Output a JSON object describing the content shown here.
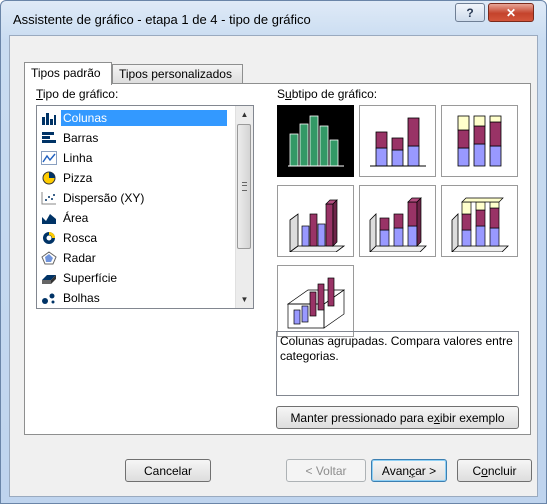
{
  "window": {
    "title": "Assistente de gráfico - etapa 1 de 4 - tipo de gráfico",
    "help_label": "?",
    "close_label": "✕"
  },
  "tabs": [
    {
      "label": "Tipos padrão",
      "active": true
    },
    {
      "label": "Tipos personalizados",
      "active": false
    }
  ],
  "chart_type_list": {
    "label": "Tipo de gráfico:",
    "items": [
      {
        "label": "Colunas",
        "icon": "column-chart-icon",
        "selected": true
      },
      {
        "label": "Barras",
        "icon": "bar-chart-icon"
      },
      {
        "label": "Linha",
        "icon": "line-chart-icon"
      },
      {
        "label": "Pizza",
        "icon": "pie-chart-icon"
      },
      {
        "label": "Dispersão (XY)",
        "icon": "scatter-chart-icon"
      },
      {
        "label": "Área",
        "icon": "area-chart-icon"
      },
      {
        "label": "Rosca",
        "icon": "doughnut-chart-icon"
      },
      {
        "label": "Radar",
        "icon": "radar-chart-icon"
      },
      {
        "label": "Superfície",
        "icon": "surface-chart-icon"
      },
      {
        "label": "Bolhas",
        "icon": "bubble-chart-icon"
      }
    ]
  },
  "subtypes": {
    "label": "Subtipo de gráfico:",
    "items": [
      {
        "name": "clustered-column",
        "selected": true
      },
      {
        "name": "stacked-column"
      },
      {
        "name": "100-stacked-column"
      },
      {
        "name": "3d-clustered-column"
      },
      {
        "name": "3d-stacked-column"
      },
      {
        "name": "3d-100-stacked-column"
      },
      {
        "name": "3d-column"
      }
    ],
    "description": "Colunas agrupadas. Compara valores entre categorias.",
    "preview_button": "Manter pressionado para exibir exemplo"
  },
  "buttons": {
    "cancel": "Cancelar",
    "back": "< Voltar",
    "next": "Avançar >",
    "finish": "Concluir"
  },
  "colors": {
    "series1": "#9999ff",
    "series2": "#993366",
    "series3": "#ffffcc",
    "selected_bg": "#000000",
    "selected_bars": "#339966",
    "list_selection": "#3399ff"
  }
}
